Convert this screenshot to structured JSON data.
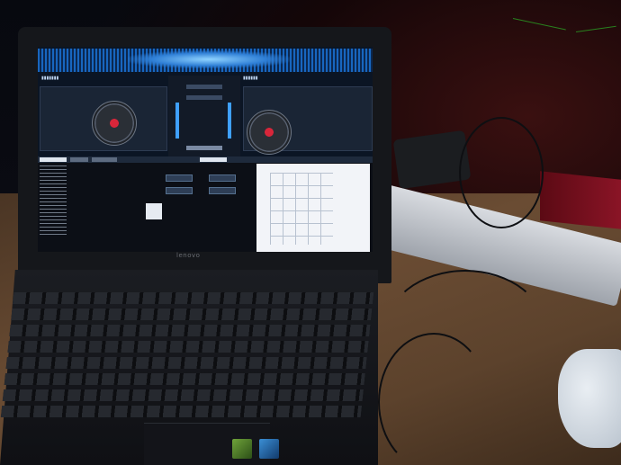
{
  "scene": {
    "description_free": true,
    "accent_colors": {
      "platter_center": "#d8263a",
      "waveform": "#1a6fd0",
      "screen_bg": "#0b1524",
      "desk": "#6a4c33"
    }
  },
  "laptop": {
    "brand": "lenovo"
  }
}
